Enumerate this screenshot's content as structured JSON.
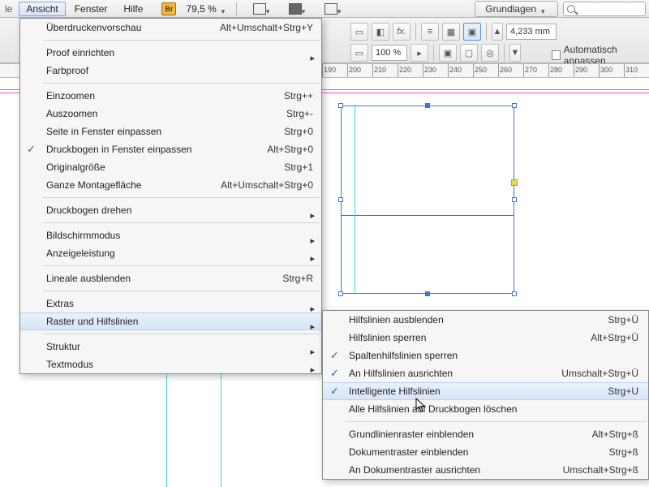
{
  "menubar": {
    "left_truncated": "le",
    "items": [
      "Ansicht",
      "Fenster",
      "Hilfe"
    ],
    "active_index": 0,
    "bridge_label": "Br",
    "zoom": "79,5 %",
    "workspace": "Grundlagen"
  },
  "toolbar2": {
    "pct_field": "100 %",
    "mm_field": "4,233 mm",
    "auto_fit_label": "Automatisch anpassen"
  },
  "ruler": {
    "start": 190,
    "end": 310,
    "step": 10
  },
  "menu": {
    "groups": [
      [
        {
          "label": "Überdruckenvorschau",
          "shortcut": "Alt+Umschalt+Strg+Y"
        }
      ],
      [
        {
          "label": "Proof einrichten",
          "submenu": true
        },
        {
          "label": "Farbproof"
        }
      ],
      [
        {
          "label": "Einzoomen",
          "shortcut": "Strg++"
        },
        {
          "label": "Auszoomen",
          "shortcut": "Strg+-"
        },
        {
          "label": "Seite in Fenster einpassen",
          "shortcut": "Strg+0"
        },
        {
          "label": "Druckbogen in Fenster einpassen",
          "shortcut": "Alt+Strg+0",
          "checked": true
        },
        {
          "label": "Originalgröße",
          "shortcut": "Strg+1"
        },
        {
          "label": "Ganze Montagefläche",
          "shortcut": "Alt+Umschalt+Strg+0"
        }
      ],
      [
        {
          "label": "Druckbogen drehen",
          "submenu": true
        }
      ],
      [
        {
          "label": "Bildschirmmodus",
          "submenu": true
        },
        {
          "label": "Anzeigeleistung",
          "submenu": true
        }
      ],
      [
        {
          "label": "Lineale ausblenden",
          "shortcut": "Strg+R"
        }
      ],
      [
        {
          "label": "Extras",
          "submenu": true
        },
        {
          "label": "Raster und Hilfslinien",
          "submenu": true,
          "hover": true
        }
      ],
      [
        {
          "label": "Struktur",
          "submenu": true
        },
        {
          "label": "Textmodus",
          "submenu": true
        }
      ]
    ]
  },
  "submenu": {
    "groups": [
      [
        {
          "label": "Hilfslinien ausblenden",
          "shortcut": "Strg+Ü"
        },
        {
          "label": "Hilfslinien sperren",
          "shortcut": "Alt+Strg+Ü"
        },
        {
          "label": "Spaltenhilfslinien sperren",
          "checked": true
        },
        {
          "label": "An Hilfslinien ausrichten",
          "shortcut": "Umschalt+Strg+Ü",
          "checked": true
        },
        {
          "label": "Intelligente Hilfslinien",
          "shortcut": "Strg+U",
          "checked": true,
          "hover": true
        },
        {
          "label": "Alle Hilfslinien auf Druckbogen löschen"
        }
      ],
      [
        {
          "label": "Grundlinienraster einblenden",
          "shortcut": "Alt+Strg+ß"
        },
        {
          "label": "Dokumentraster einblenden",
          "shortcut": "Strg+ß"
        },
        {
          "label": "An Dokumentraster ausrichten",
          "shortcut": "Umschalt+Strg+ß"
        }
      ]
    ]
  }
}
